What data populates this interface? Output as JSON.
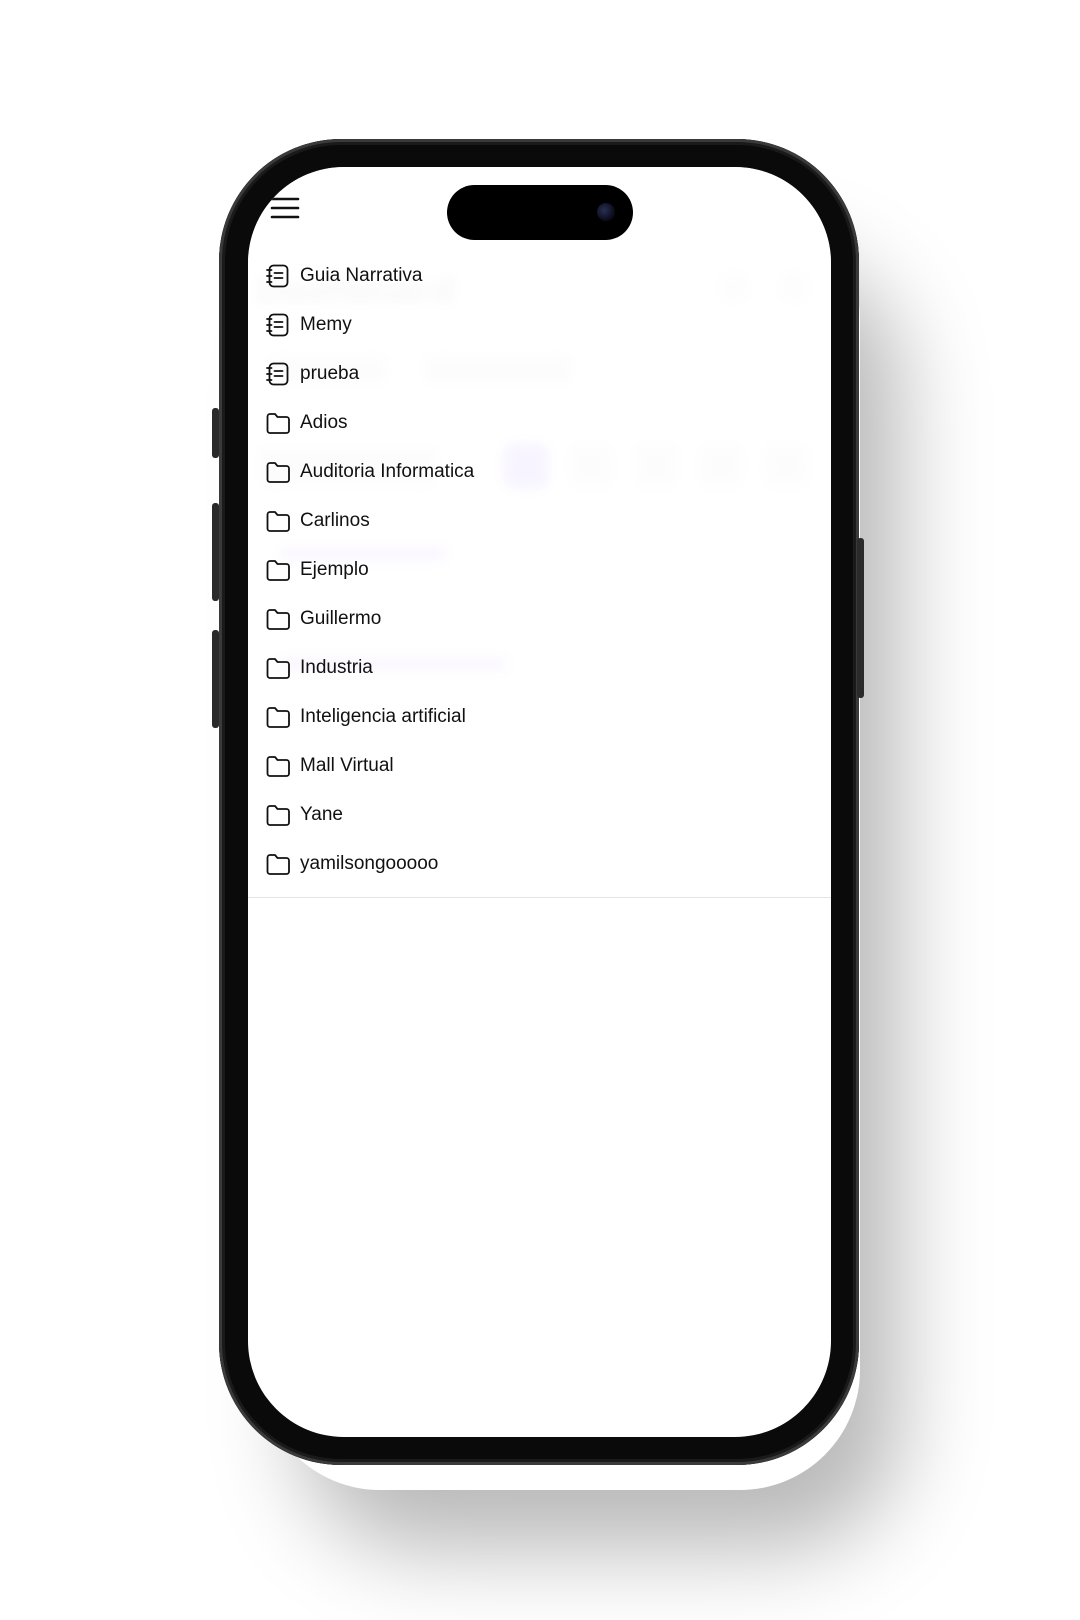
{
  "background_page": {
    "title": "Dashboard"
  },
  "drawer": {
    "menu_icon": "hamburger-menu-icon",
    "items": [
      {
        "label": "Guia Narrativa",
        "icon": "notebook-icon"
      },
      {
        "label": "Memy",
        "icon": "notebook-icon"
      },
      {
        "label": "prueba",
        "icon": "notebook-icon"
      },
      {
        "label": "Adios",
        "icon": "folder-icon"
      },
      {
        "label": "Auditoria Informatica",
        "icon": "folder-icon"
      },
      {
        "label": "Carlinos",
        "icon": "folder-icon"
      },
      {
        "label": "Ejemplo",
        "icon": "folder-icon"
      },
      {
        "label": "Guillermo",
        "icon": "folder-icon"
      },
      {
        "label": "Industria",
        "icon": "folder-icon"
      },
      {
        "label": "Inteligencia artificial",
        "icon": "folder-icon"
      },
      {
        "label": "Mall Virtual",
        "icon": "folder-icon"
      },
      {
        "label": "Yane",
        "icon": "folder-icon"
      },
      {
        "label": "yamilsongooooo",
        "icon": "folder-icon"
      }
    ]
  },
  "colors": {
    "accent": "#cdb8ff",
    "text": "#111111",
    "divider": "#e4e4e4"
  }
}
